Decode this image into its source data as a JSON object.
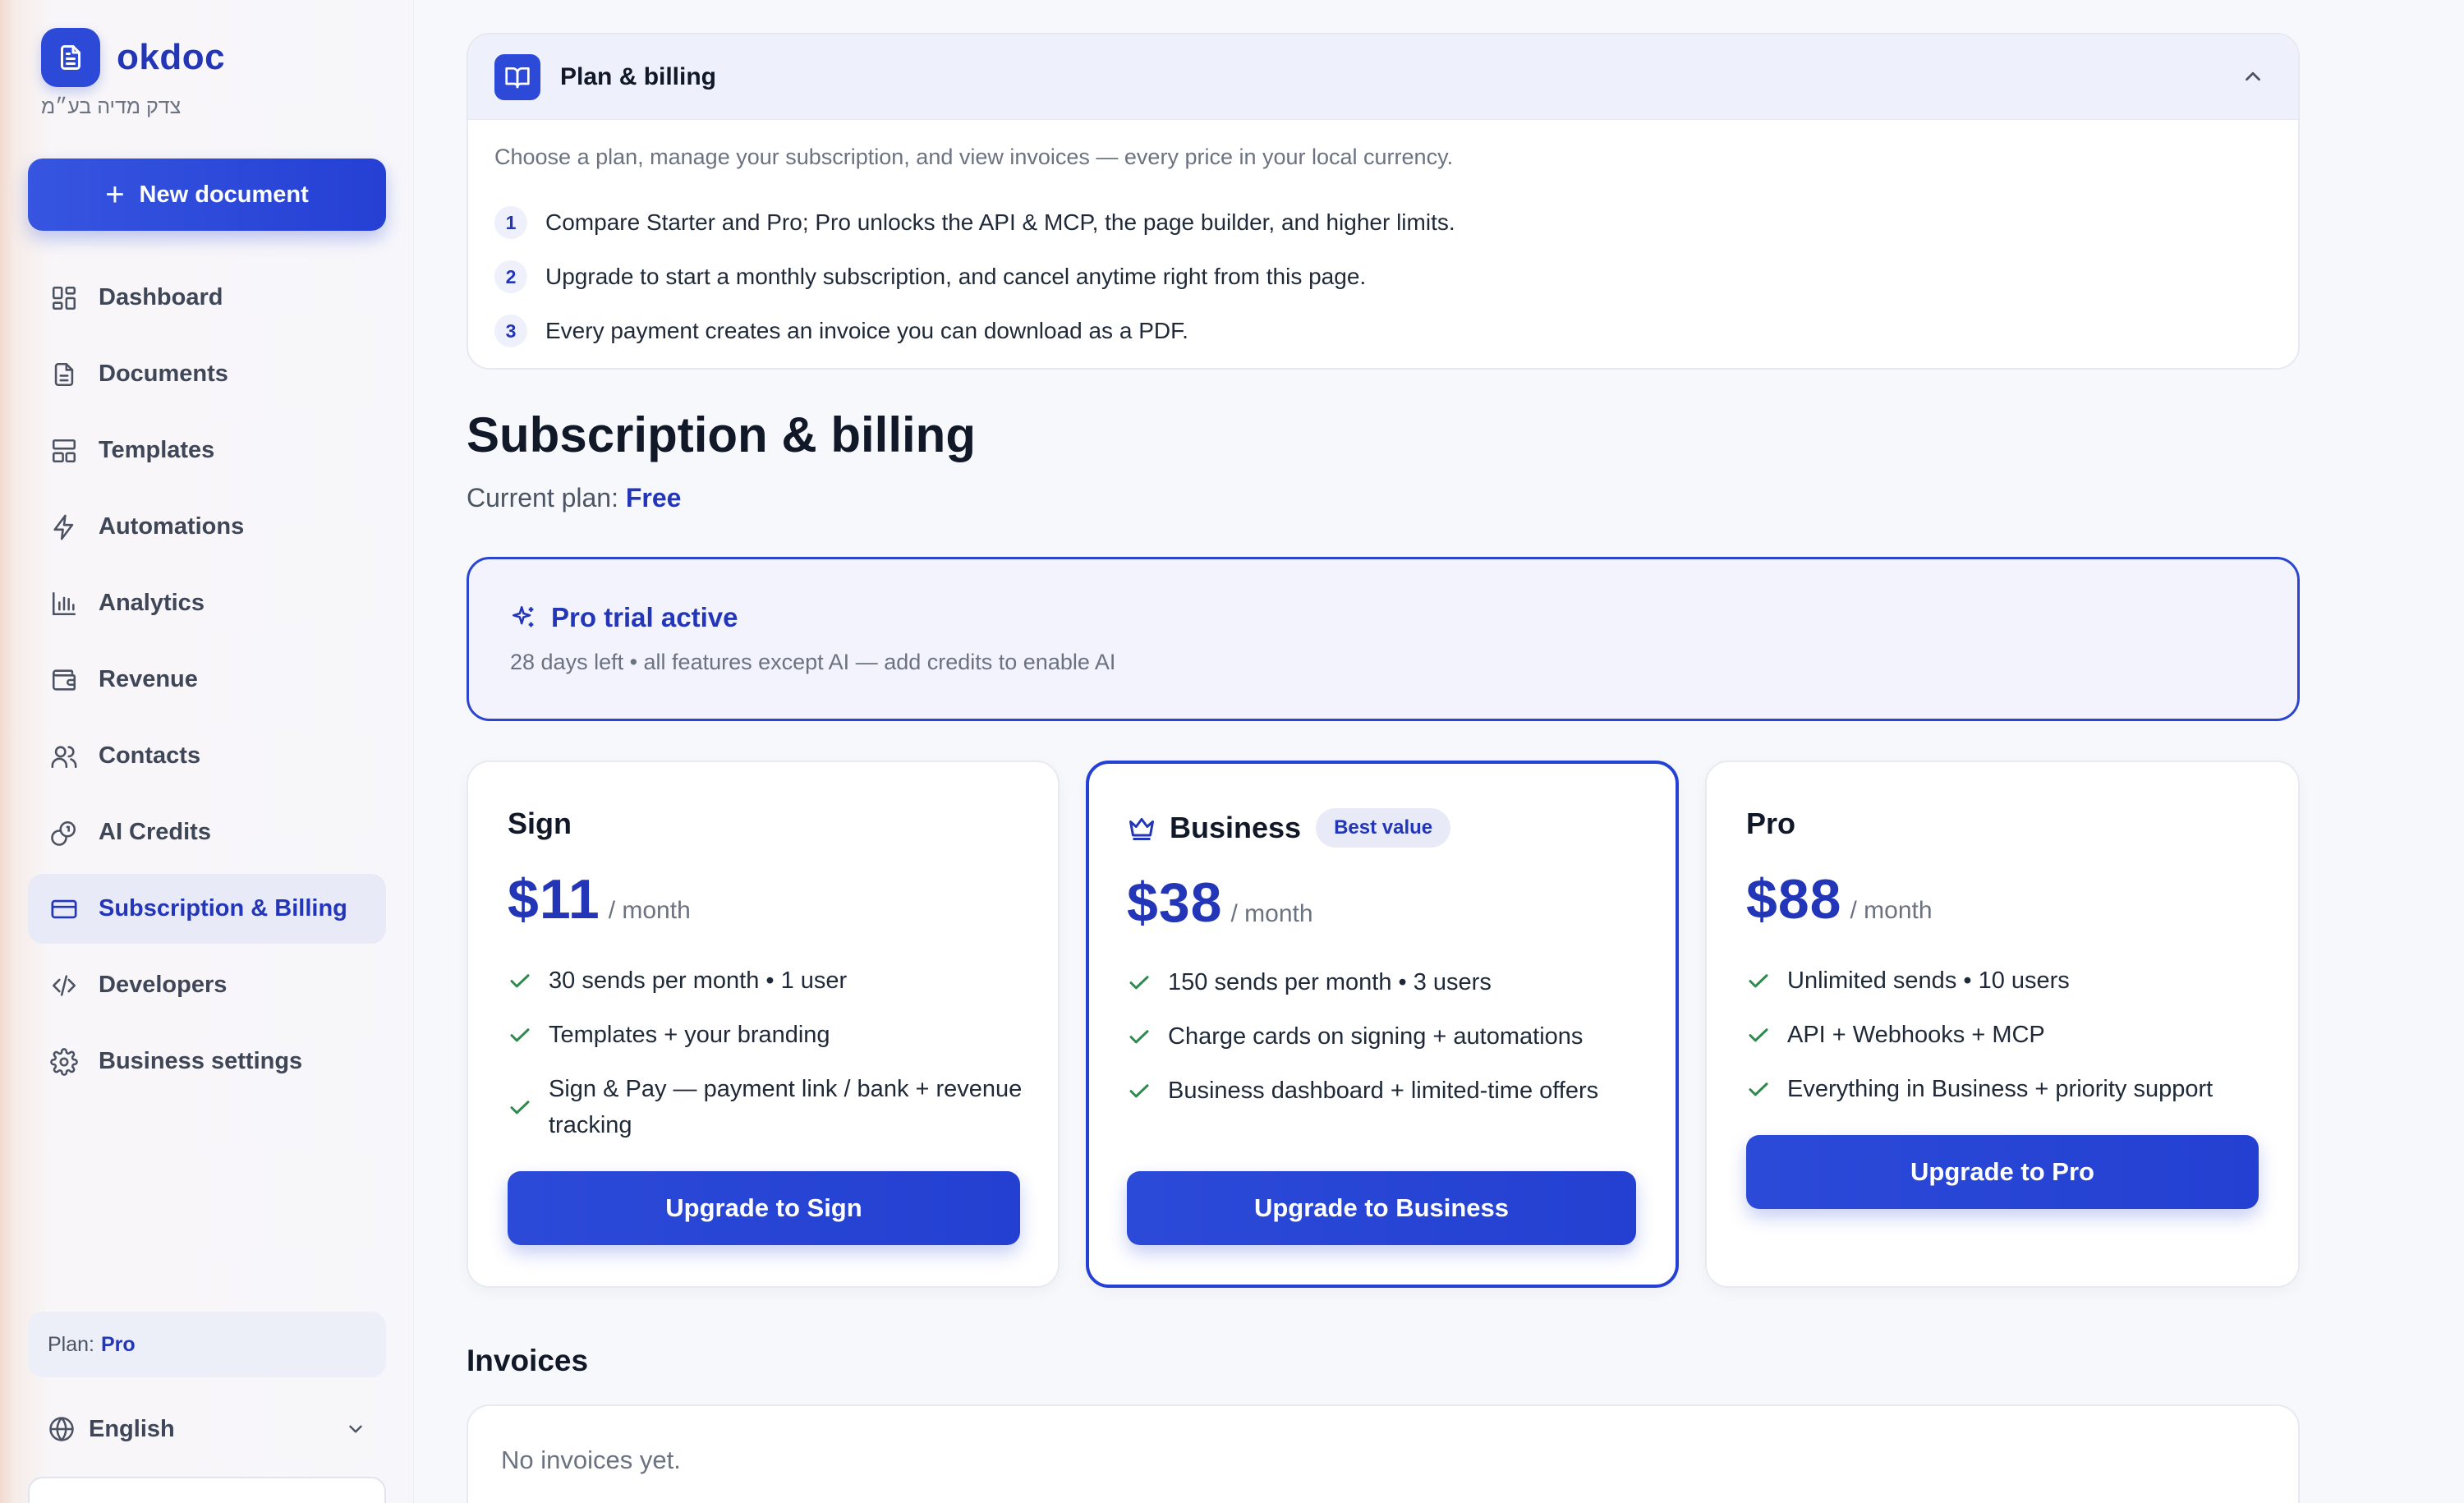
{
  "brand": {
    "name": "okdoc",
    "subtitle": "צדק מדיה בע״מ"
  },
  "sidebar": {
    "new_document": "New document",
    "items": [
      {
        "label": "Dashboard",
        "icon": "dashboard-icon"
      },
      {
        "label": "Documents",
        "icon": "document-icon"
      },
      {
        "label": "Templates",
        "icon": "templates-icon"
      },
      {
        "label": "Automations",
        "icon": "bolt-icon"
      },
      {
        "label": "Analytics",
        "icon": "bar-chart-icon"
      },
      {
        "label": "Revenue",
        "icon": "wallet-icon"
      },
      {
        "label": "Contacts",
        "icon": "users-icon"
      },
      {
        "label": "AI Credits",
        "icon": "coins-icon"
      },
      {
        "label": "Subscription & Billing",
        "icon": "credit-card-icon",
        "active": true
      },
      {
        "label": "Developers",
        "icon": "code-icon"
      },
      {
        "label": "Business settings",
        "icon": "gear-icon"
      }
    ],
    "plan_label": "Plan:",
    "plan_value": "Pro",
    "language": "English"
  },
  "guide": {
    "title": "Plan & billing",
    "intro": "Choose a plan, manage your subscription, and view invoices — every price in your local currency.",
    "steps": [
      {
        "num": "1",
        "text": "Compare Starter and Pro; Pro unlocks the API & MCP, the page builder, and higher limits."
      },
      {
        "num": "2",
        "text": "Upgrade to start a monthly subscription, and cancel anytime right from this page."
      },
      {
        "num": "3",
        "text": "Every payment creates an invoice you can download as a PDF."
      }
    ]
  },
  "page": {
    "title": "Subscription & billing",
    "current_plan_label": "Current plan:",
    "current_plan_value": "Free"
  },
  "trial": {
    "title": "Pro trial active",
    "subtitle": "28 days left • all features except AI — add credits to enable AI"
  },
  "plans": [
    {
      "name": "Sign",
      "price": "$11",
      "period": "/ month",
      "features": [
        "30 sends per month • 1 user",
        "Templates + your branding",
        "Sign & Pay — payment link / bank + revenue tracking"
      ],
      "button": "Upgrade to Sign"
    },
    {
      "name": "Business",
      "badge": "Best value",
      "price": "$38",
      "period": "/ month",
      "features": [
        "150 sends per month • 3 users",
        "Charge cards on signing + automations",
        "Business dashboard + limited-time offers"
      ],
      "button": "Upgrade to Business"
    },
    {
      "name": "Pro",
      "price": "$88",
      "period": "/ month",
      "features": [
        "Unlimited sends • 10 users",
        "API + Webhooks + MCP",
        "Everything in Business + priority support"
      ],
      "button": "Upgrade to Pro"
    }
  ],
  "invoices": {
    "title": "Invoices",
    "empty": "No invoices yet."
  },
  "colors": {
    "brand": "#2c49d8",
    "accent_text": "#2336b8",
    "check": "#2f8a4e",
    "active_nav_bg": "#e8eaf7"
  }
}
